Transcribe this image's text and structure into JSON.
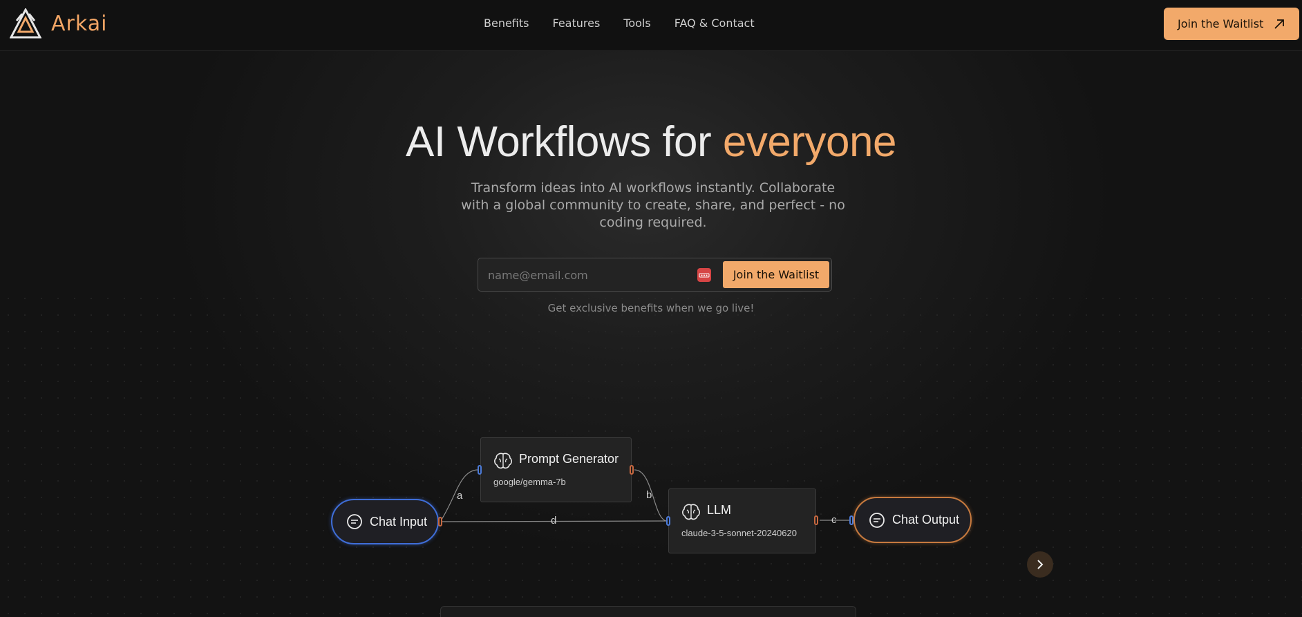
{
  "brand": {
    "name": "Arkai",
    "logo_icon": "arkai-triangle-logo"
  },
  "nav": {
    "items": [
      {
        "label": "Benefits"
      },
      {
        "label": "Features"
      },
      {
        "label": "Tools"
      },
      {
        "label": "FAQ & Contact"
      }
    ],
    "cta_label": "Join the Waitlist",
    "cta_icon": "arrow-up-right-icon"
  },
  "hero": {
    "title_main": "AI Workflows for ",
    "title_accent": "everyone",
    "subtitle": "Transform ideas into AI workflows instantly. Collaborate with a global community to create, share, and perfect - no coding required.",
    "email_placeholder": "name@email.com",
    "submit_label": "Join the Waitlist",
    "note": "Get exclusive benefits when we go live!"
  },
  "workflow": {
    "nodes": {
      "chat_input": {
        "label": "Chat Input",
        "icon": "chat-bubble-icon"
      },
      "prompt_generator": {
        "title": "Prompt Generator",
        "model": "google/gemma-7b",
        "icon": "brain-icon"
      },
      "llm": {
        "title": "LLM",
        "model": "claude-3-5-sonnet-20240620",
        "icon": "brain-icon"
      },
      "chat_output": {
        "label": "Chat Output",
        "icon": "chat-bubble-icon"
      }
    },
    "edges": {
      "a": "a",
      "b": "b",
      "c": "c",
      "d": "d"
    }
  },
  "colors": {
    "accent": "#f2a96a",
    "input_port": "#4c7bd9",
    "output_port": "#c76840",
    "background": "#121212"
  }
}
